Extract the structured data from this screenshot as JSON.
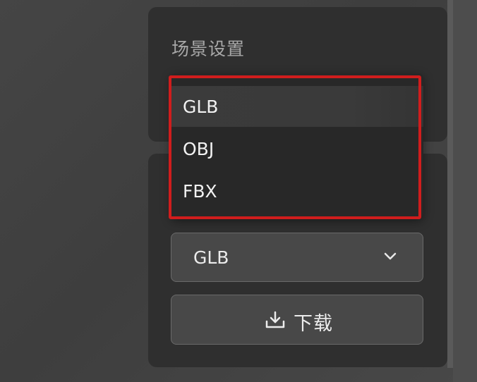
{
  "scene_panel": {
    "title": "场景设置"
  },
  "export_panel": {
    "format_select": {
      "value": "GLB",
      "icon": "chevron-down-icon"
    },
    "download_button": {
      "label": "下载",
      "icon": "download-icon"
    }
  },
  "format_dropdown": {
    "options": [
      "GLB",
      "OBJ",
      "FBX"
    ],
    "highlighted": "GLB"
  },
  "colors": {
    "highlight_frame": "#d01d1d",
    "panel_bg": "#2f2f2f",
    "control_bg": "#484848"
  }
}
